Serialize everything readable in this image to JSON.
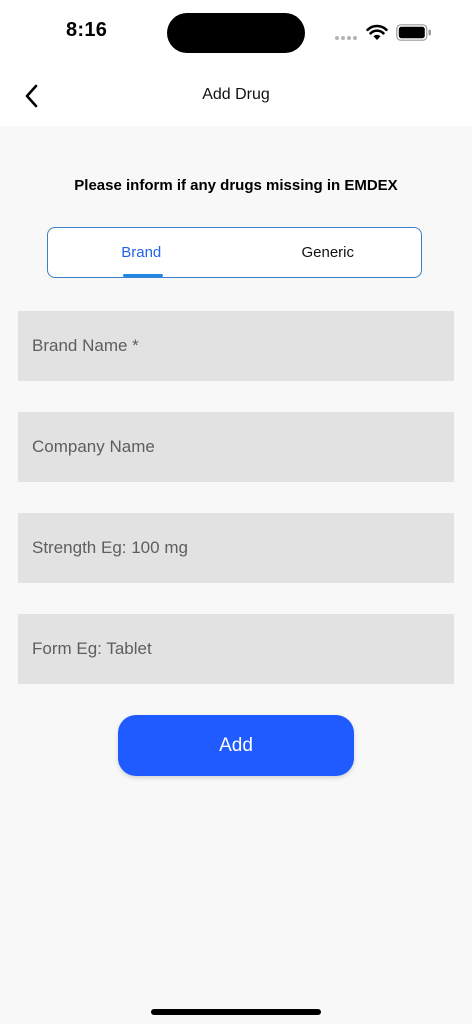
{
  "status_bar": {
    "time": "8:16",
    "icons": [
      "signal-icon",
      "wifi-icon",
      "battery-icon"
    ]
  },
  "nav": {
    "title": "Add Drug",
    "back_icon": "chevron-left-icon"
  },
  "notice": "Please inform if any drugs missing in EMDEX",
  "tabs": [
    {
      "label": "Brand",
      "selected": true
    },
    {
      "label": "Generic",
      "selected": false
    }
  ],
  "form": {
    "brand_name_placeholder": "Brand Name *",
    "company_name_placeholder": "Company Name",
    "strength_placeholder": "Strength Eg: 100 mg",
    "form_placeholder": "Form Eg: Tablet"
  },
  "add_button_label": "Add",
  "colors": {
    "accent": "#1f5bff",
    "tab_active": "#2563eb",
    "tab_border": "#3d7fc4",
    "field_bg": "#e2e2e2",
    "page_bg": "#f8f8f8"
  }
}
